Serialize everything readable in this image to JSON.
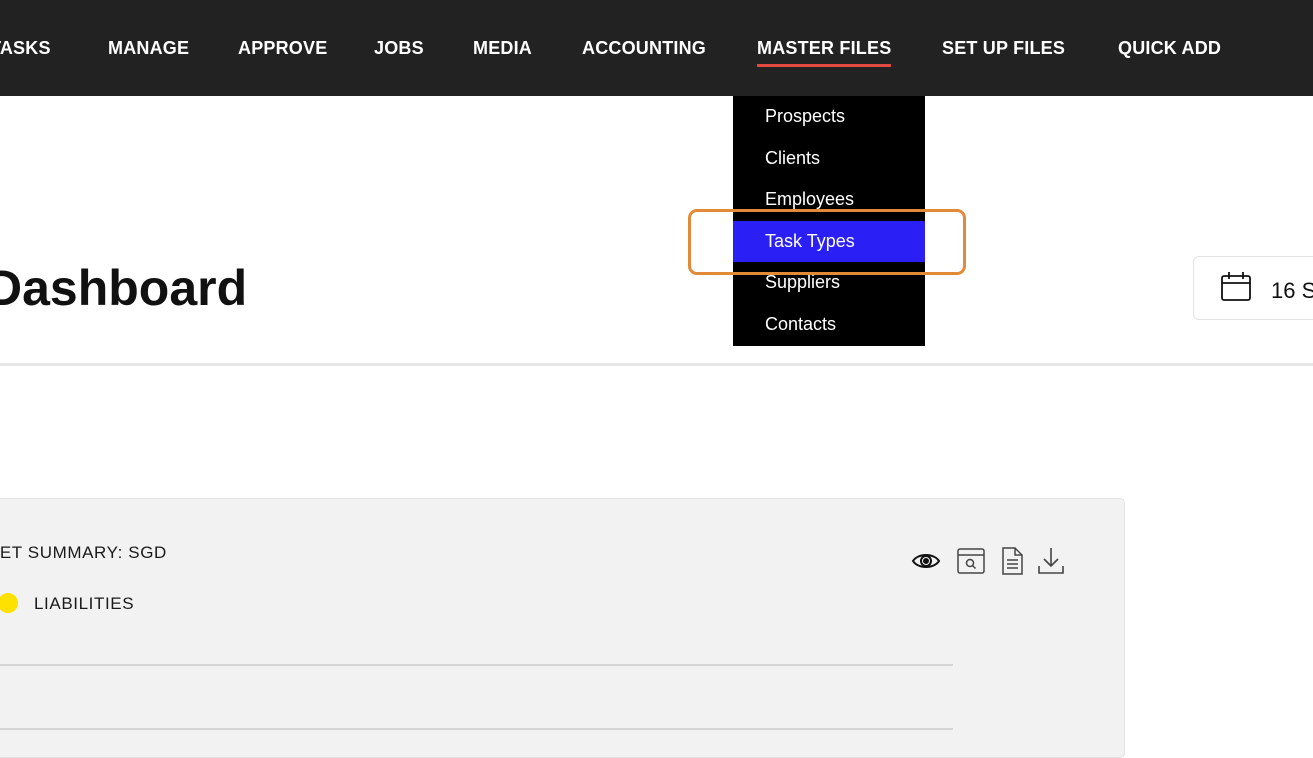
{
  "nav": {
    "items": [
      {
        "label": "TASKS"
      },
      {
        "label": "MANAGE"
      },
      {
        "label": "APPROVE"
      },
      {
        "label": "JOBS"
      },
      {
        "label": "MEDIA"
      },
      {
        "label": "ACCOUNTING"
      },
      {
        "label": "MASTER FILES",
        "active": true
      },
      {
        "label": "SET UP FILES"
      },
      {
        "label": "QUICK ADD"
      }
    ]
  },
  "dropdown": {
    "items": [
      {
        "label": "Prospects"
      },
      {
        "label": "Clients"
      },
      {
        "label": "Employees"
      },
      {
        "label": "Task Types",
        "highlighted": true
      },
      {
        "label": "Suppliers"
      },
      {
        "label": "Contacts"
      }
    ]
  },
  "page": {
    "title": "Dashboard"
  },
  "date_picker": {
    "icon": "calendar-icon",
    "value": "16 S"
  },
  "summary_card": {
    "title": "ASSET SUMMARY: SGD",
    "legend": [
      {
        "label": "LIABILITIES",
        "color": "#ffe100"
      }
    ],
    "tools": [
      {
        "icon": "eye-icon"
      },
      {
        "icon": "search-window-icon"
      },
      {
        "icon": "document-icon"
      },
      {
        "icon": "download-icon"
      }
    ]
  },
  "colors": {
    "nav_bg": "#222222",
    "active_underline": "#e04a3f",
    "dropdown_bg": "#000000",
    "dropdown_highlight": "#2a1ff5",
    "focus_ring": "#e28a38"
  }
}
